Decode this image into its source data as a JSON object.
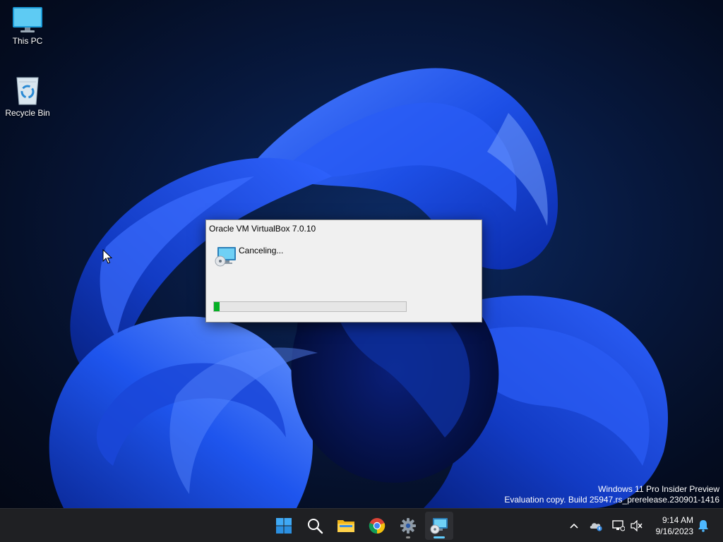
{
  "desktop": {
    "icons": [
      {
        "label": "This PC",
        "icon": "monitor-icon"
      },
      {
        "label": "Recycle Bin",
        "icon": "recycle-bin-icon"
      }
    ]
  },
  "dialog": {
    "title": "Oracle VM VirtualBox 7.0.10",
    "message": "Canceling...",
    "icon": "virtualbox-disc-monitor-icon",
    "progress_fraction": 0.03,
    "progress_color": "#06b025"
  },
  "watermark": {
    "line1": "Windows 11 Pro Insider Preview",
    "line2": "Evaluation copy. Build 25947.rs_prerelease.230901-1416"
  },
  "taskbar": {
    "apps": [
      {
        "icon": "windows-start-icon",
        "running": false
      },
      {
        "icon": "search-icon",
        "running": false
      },
      {
        "icon": "file-explorer-icon",
        "running": false
      },
      {
        "icon": "chrome-icon",
        "running": false
      },
      {
        "icon": "settings-gear-icon",
        "running": true
      },
      {
        "icon": "virtualbox-icon",
        "running": true,
        "active": true
      }
    ],
    "tray": {
      "icons": [
        "chevron-up-icon",
        "onedrive-icon",
        "network-icon",
        "volume-muted-icon",
        "notification-bell-icon"
      ],
      "time": "9:14 AM",
      "date": "9/16/2023"
    }
  },
  "colors": {
    "wallpaper_dark": "#040c20",
    "bloom_blue": "#1d4fe6",
    "taskbar_bg": "#1f2023",
    "accent": "#60cdff"
  }
}
